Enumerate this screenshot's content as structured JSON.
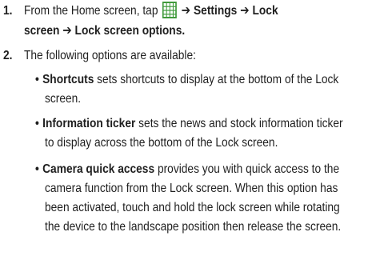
{
  "steps": [
    {
      "number": "1.",
      "l1_pre": "From the Home screen, tap",
      "l1_icon": "apps-grid-icon",
      "l1_arrow1": "➔",
      "l1_settings": "Settings",
      "l1_arrow2": "➔",
      "l1_lock": "Lock",
      "l2_lockscreen": "screen",
      "l2_arrow": "➔",
      "l2_options": "Lock screen options",
      "l2_period": "."
    },
    {
      "number": "2.",
      "text": "The following options are available:"
    }
  ],
  "options": [
    {
      "term": "Shortcuts",
      "l1_rest": "sets shortcuts to display at the bottom of the Lock",
      "l2": "screen."
    },
    {
      "term": "Information ticker",
      "l1_rest": "sets the news and stock information ticker",
      "l2": "to display across the bottom of the Lock screen."
    },
    {
      "term": "Camera quick access",
      "l1_rest": "provides you with quick access to the",
      "l2": "camera function from the Lock screen. When this option has",
      "l3": "been activated, touch and hold the lock screen while rotating",
      "l4": "the device to the landscape position then release the screen."
    }
  ],
  "colors": {
    "icon_green": "#3f9a3a",
    "text": "#1f1f1f"
  }
}
